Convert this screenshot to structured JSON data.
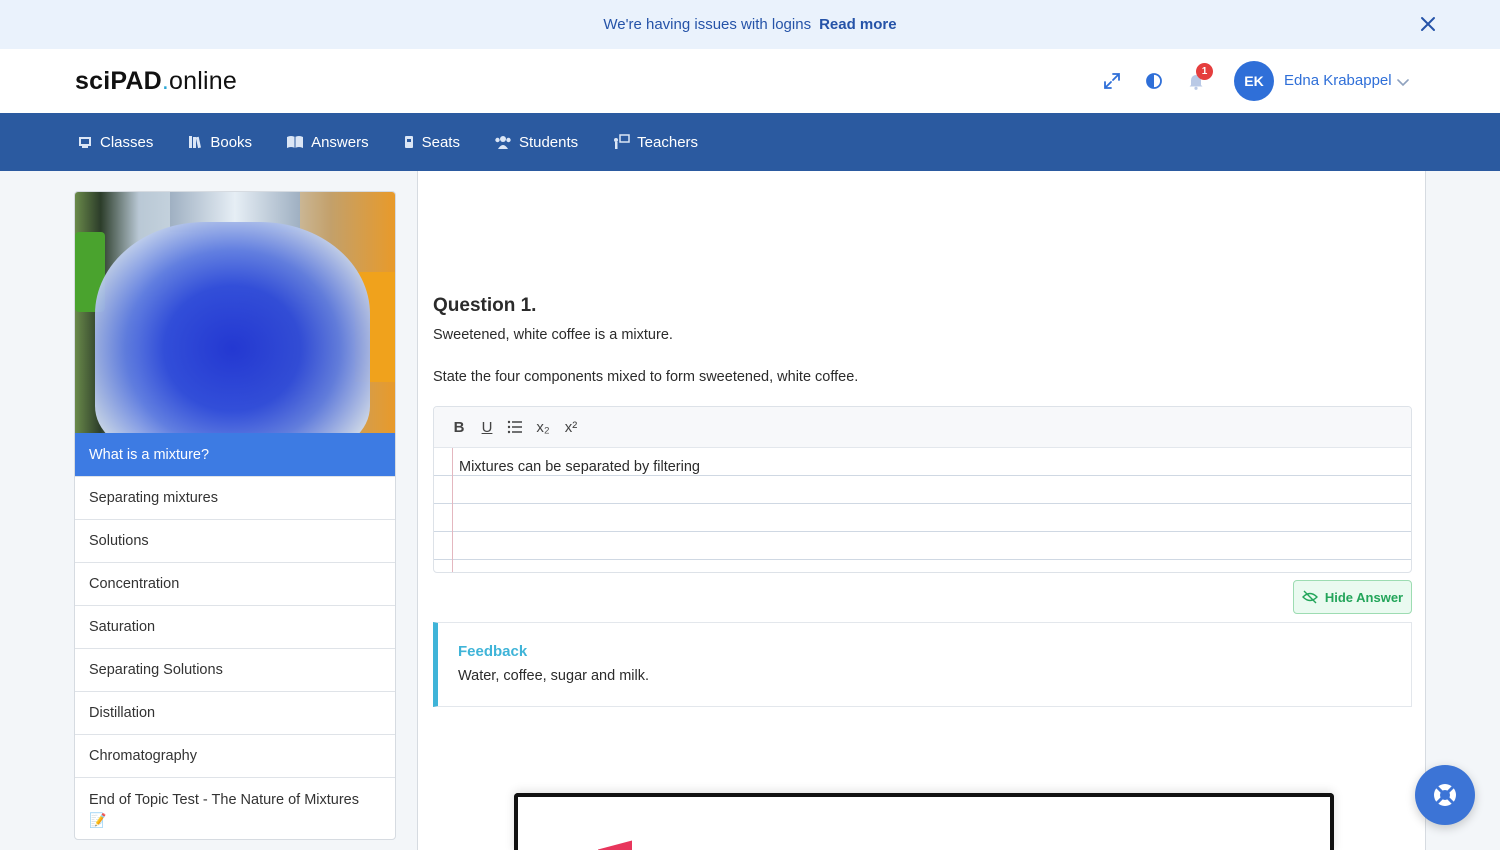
{
  "banner": {
    "message": "We're having issues with logins",
    "link": "Read more"
  },
  "brand": {
    "part1": "sciPAD",
    "dot": ".",
    "part2": "online"
  },
  "user": {
    "initials": "EK",
    "name": "Edna Krabappel"
  },
  "notifications": {
    "count": "1"
  },
  "nav": [
    {
      "label": "Classes",
      "icon": "classes-icon"
    },
    {
      "label": "Books",
      "icon": "books-icon"
    },
    {
      "label": "Answers",
      "icon": "answers-icon"
    },
    {
      "label": "Seats",
      "icon": "seats-icon"
    },
    {
      "label": "Students",
      "icon": "students-icon"
    },
    {
      "label": "Teachers",
      "icon": "teachers-icon"
    }
  ],
  "sidebar": {
    "lessons": [
      {
        "label": "What is a mixture?",
        "active": true
      },
      {
        "label": "Separating mixtures"
      },
      {
        "label": "Solutions"
      },
      {
        "label": "Concentration"
      },
      {
        "label": "Saturation"
      },
      {
        "label": "Separating Solutions"
      },
      {
        "label": "Distillation"
      },
      {
        "label": "Chromatography"
      },
      {
        "label": "End of Topic Test - The Nature of Mixtures",
        "badge": "📝"
      }
    ]
  },
  "question": {
    "title": "Question 1.",
    "line1": "Sweetened, white coffee is a mixture.",
    "line2": "State the four components mixed to form sweetened, white coffee.",
    "answer": "Mixtures can be separated by filtering"
  },
  "editor_toolbar": {
    "bold": "B",
    "underline": "U",
    "subscript": "x₂",
    "superscript": "x²"
  },
  "hide_answer": "Hide Answer",
  "feedback": {
    "title": "Feedback",
    "text": "Water, coffee, sugar and milk."
  },
  "colors": {
    "nav": "#2b5aa0",
    "active": "#3d7be3",
    "accent": "#2f6fd8",
    "feedback": "#3fb4d8",
    "success": "#23a55a"
  }
}
